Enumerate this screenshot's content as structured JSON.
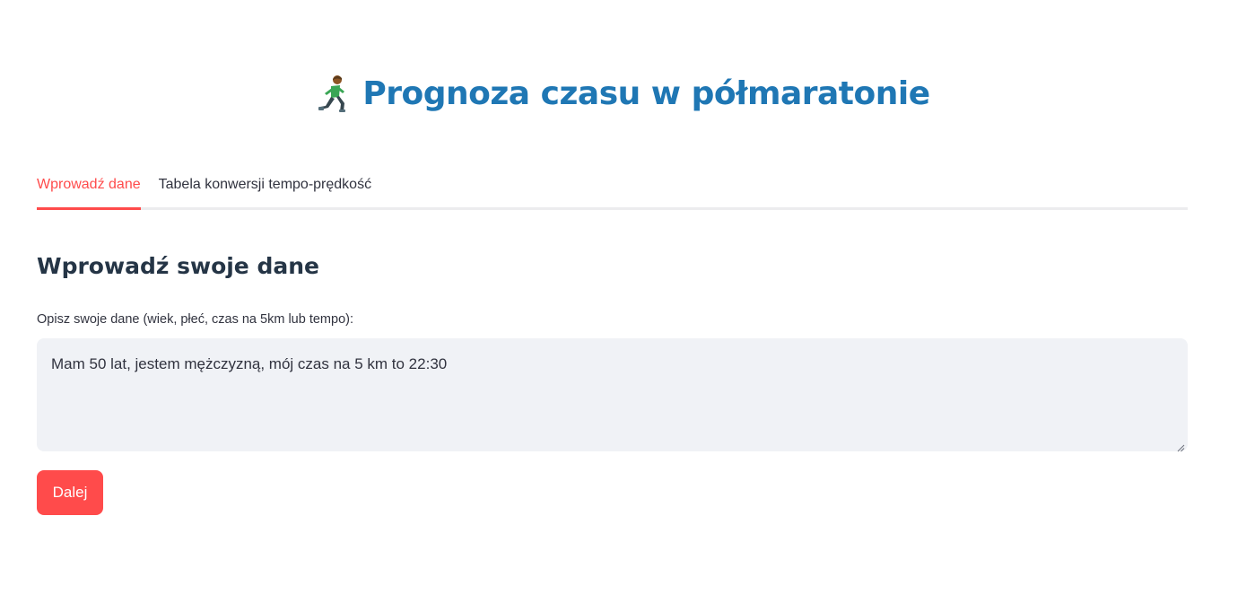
{
  "header": {
    "icon": "person-running-icon",
    "title": "Prognoza czasu w półmaratonie"
  },
  "tabs": [
    {
      "label": "Wprowadź dane",
      "active": true
    },
    {
      "label": "Tabela konwersji tempo-prędkość",
      "active": false
    }
  ],
  "form": {
    "section_title": "Wprowadź swoje dane",
    "field_label": "Opisz swoje dane (wiek, płeć, czas na 5km lub tempo):",
    "field_value": "Mam 50 lat, jestem mężczyzną, mój czas na 5 km to 22:30",
    "submit_label": "Dalej"
  },
  "colors": {
    "title": "#1f77b4",
    "accent": "#ff4b4b",
    "input_background": "#f0f2f6",
    "section_title": "#253546"
  }
}
